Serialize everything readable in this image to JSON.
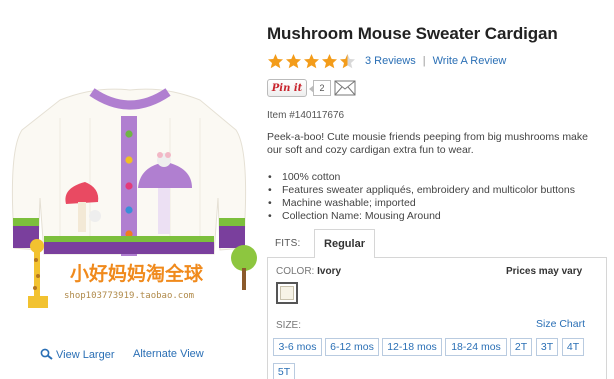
{
  "product": {
    "title": "Mushroom Mouse Sweater Cardigan",
    "rating": 4.5,
    "rating_max": 5,
    "reviews_link": "3 Reviews",
    "separator": "|",
    "write_review": "Write A Review",
    "pinit_label": "Pin it",
    "pin_count": "2",
    "item_number": "Item #140117676",
    "description": "Peek-a-boo! Cute mousie friends peeping from big mushrooms make our soft and cozy cardigan extra fun to wear.",
    "features": [
      "100% cotton",
      "Features sweater appliqués, embroidery and multicolor buttons",
      "Machine washable; imported",
      "Collection Name: Mousing Around"
    ]
  },
  "fits": {
    "label": "FITS:",
    "selected_tab": "Regular"
  },
  "color": {
    "label": "COLOR:",
    "value": "Ivory",
    "prices_note": "Prices may vary",
    "swatch_color": "#f7f3e6"
  },
  "sizes": {
    "label": "SIZE:",
    "chart_link": "Size Chart",
    "options": [
      "3-6 mos",
      "6-12 mos",
      "12-18 mos",
      "18-24 mos",
      "2T",
      "3T",
      "4T",
      "5T"
    ]
  },
  "image_links": {
    "view_larger": "View Larger",
    "alternate_view": "Alternate View"
  },
  "watermark": {
    "text_cn": "小好妈妈淘全球",
    "url": "shop103773919.taobao.com"
  },
  "colors": {
    "link": "#2a6fb5",
    "star": "#f39c1a",
    "sweater_trim": "#b07fd0"
  }
}
